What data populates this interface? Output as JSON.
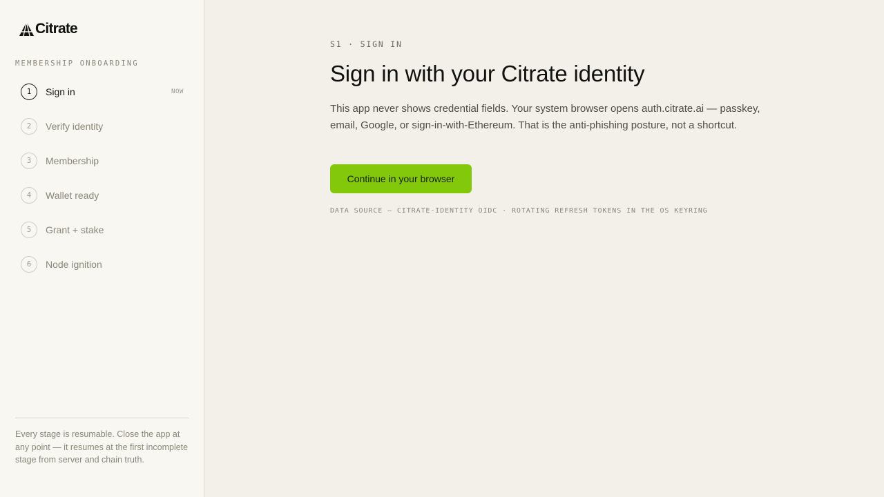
{
  "sidebar": {
    "logo_text": "Citrate",
    "logo_icon": "triangle-mark-icon",
    "section_label": "MEMBERSHIP ONBOARDING",
    "steps": [
      {
        "number": "1",
        "label": "Sign in",
        "badge": "NOW",
        "active": true
      },
      {
        "number": "2",
        "label": "Verify identity",
        "active": false
      },
      {
        "number": "3",
        "label": "Membership",
        "active": false
      },
      {
        "number": "4",
        "label": "Wallet ready",
        "active": false
      },
      {
        "number": "5",
        "label": "Grant + stake",
        "active": false
      },
      {
        "number": "6",
        "label": "Node ignition",
        "active": false
      }
    ],
    "note": "Every stage is resumable. Close the app at any point — it resumes at the first incomplete stage from server and chain truth."
  },
  "main": {
    "eyebrow": "S1 · SIGN IN",
    "title": "Sign in with your Citrate identity",
    "description": "This app never shows credential fields. Your system browser opens auth.citrate.ai — passkey, email, Google, or sign-in-with-Ethereum. That is the anti-phishing posture, not a shortcut.",
    "cta_label": "Continue in your browser",
    "data_source": "DATA SOURCE — CITRATE-IDENTITY OIDC · ROTATING REFRESH TOKENS IN THE OS KEYRING"
  },
  "colors": {
    "accent": "#84c80c",
    "sidebar_bg": "#f8f7f2",
    "main_bg": "#f3f0e9",
    "text_primary": "#111110",
    "text_muted": "#8a8779"
  }
}
